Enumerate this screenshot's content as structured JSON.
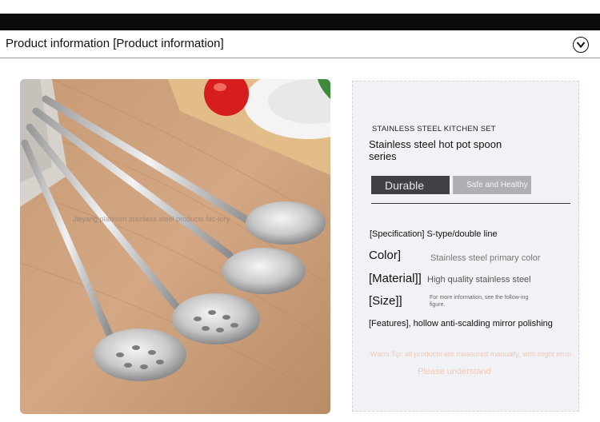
{
  "header": {
    "title": "Product information [Product information]",
    "toggle_icon": "chevron-down-circle-icon"
  },
  "photo": {
    "watermark": "Jieyang platinum stainless steel products fac-tory"
  },
  "panel": {
    "eyebrow": "STAINLESS STEEL KITCHEN SET",
    "title": "Stainless steel hot pot spoon series",
    "tags": [
      "Durable",
      "Safe and Healthy"
    ],
    "specification": "[Specification] S-type/double line",
    "color_label": "Color]",
    "color_value": "Stainless steel primary color",
    "material_label": "[Material]]",
    "material_value": "High quality stainless steel",
    "size_label": "[Size]]",
    "size_note": "For more information, see the follow-ing figure.",
    "features": "[Features], hollow anti-scalding mirror polishing",
    "tip": "Warm Tip: all products are measured manually, with slight error.",
    "please": "Please understand"
  },
  "colors": {
    "dark_tag": "#3f4147",
    "light_tag": "#aeb0b6",
    "tip_text": "#f0c9b4",
    "panel_bg": "#f1f2f6"
  }
}
